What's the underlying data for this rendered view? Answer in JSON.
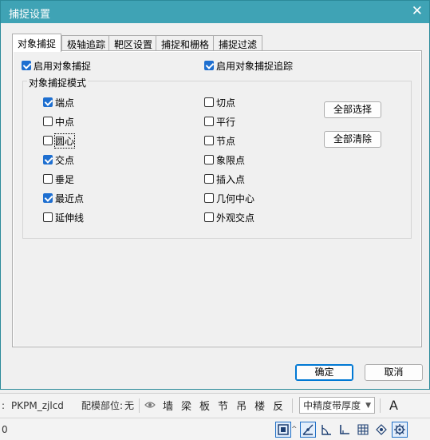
{
  "dialog": {
    "title": "捕捉设置",
    "close_glyph": "✕"
  },
  "tabs": [
    {
      "label": "对象捕捉",
      "active": true
    },
    {
      "label": "极轴追踪",
      "active": false
    },
    {
      "label": "靶区设置",
      "active": false
    },
    {
      "label": "捕捉和栅格",
      "active": false
    },
    {
      "label": "捕捉过滤",
      "active": false
    }
  ],
  "panel": {
    "enable_osnap": {
      "label": "启用对象捕捉",
      "checked": true
    },
    "enable_tracking": {
      "label": "启用对象捕捉追踪",
      "checked": true
    },
    "group_title": "对象捕捉模式",
    "modes_left": [
      {
        "label": "端点",
        "checked": true
      },
      {
        "label": "中点",
        "checked": false
      },
      {
        "label": "圆心",
        "checked": false
      },
      {
        "label": "交点",
        "checked": true
      },
      {
        "label": "垂足",
        "checked": false
      },
      {
        "label": "最近点",
        "checked": true
      },
      {
        "label": "延伸线",
        "checked": false
      }
    ],
    "modes_right": [
      {
        "label": "切点",
        "checked": false
      },
      {
        "label": "平行",
        "checked": false
      },
      {
        "label": "节点",
        "checked": false
      },
      {
        "label": "象限点",
        "checked": false
      },
      {
        "label": "插入点",
        "checked": false
      },
      {
        "label": "几何中心",
        "checked": false
      },
      {
        "label": "外观交点",
        "checked": false
      }
    ],
    "select_all_label": "全部选择",
    "clear_all_label": "全部清除"
  },
  "footer": {
    "ok_label": "确定",
    "cancel_label": "取消"
  },
  "toolbar": {
    "project_prefix": ":",
    "project_name": "PKPM_zjlcd",
    "config_label": "配模部位:",
    "config_value": "无",
    "eye_icon": "eye-icon",
    "buttons": [
      "墙",
      "梁",
      "板",
      "节",
      "吊",
      "楼",
      "反"
    ],
    "precision_select": "中精度带厚度",
    "font_button": "A"
  },
  "statusbar": {
    "left_value": "0",
    "icons": [
      "snap-box-icon",
      "ortho-icon",
      "polar-icon",
      "osnap-track-icon",
      "grid-icon",
      "cursor-icon",
      "settings-gear-icon"
    ]
  }
}
